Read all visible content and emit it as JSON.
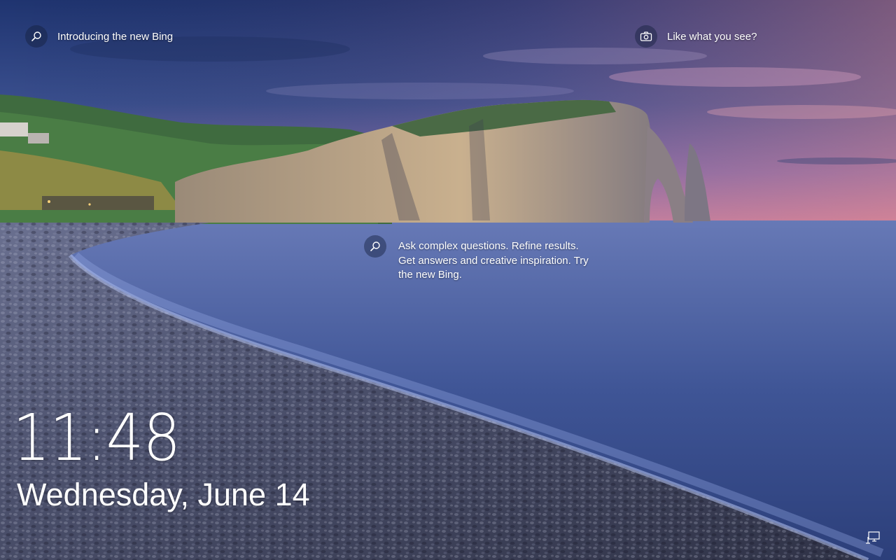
{
  "lock_screen": {
    "bing_promo_top": {
      "icon": "search-icon",
      "label": "Introducing the new Bing"
    },
    "spotlight": {
      "icon": "camera-icon",
      "label": "Like what you see?"
    },
    "bing_promo_mid": {
      "icon": "search-icon",
      "text": "Ask complex questions. Refine results. Get answers and creative inspiration. Try the new Bing."
    },
    "clock": {
      "time": "11:48",
      "date": "Wednesday, June 14"
    },
    "status": {
      "network_icon": "network-icon"
    }
  }
}
